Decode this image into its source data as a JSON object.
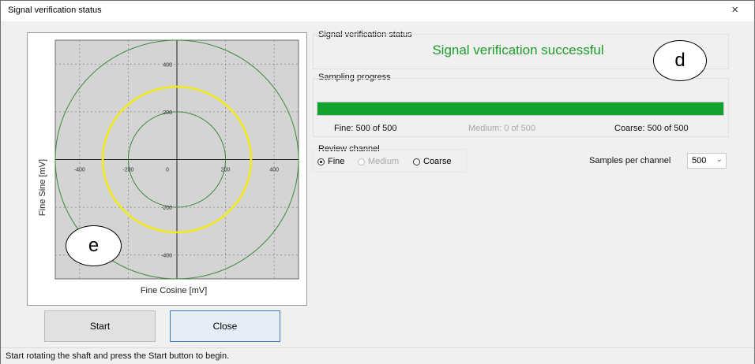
{
  "window": {
    "title": "Signal verification status",
    "close_symbol": "×"
  },
  "plot": {
    "xlabel": "Fine Cosine [mV]",
    "ylabel": "Fine Sine [mV]",
    "chart_data": {
      "type": "scatter",
      "xlim": [
        -500,
        500
      ],
      "ylim": [
        -500,
        500
      ],
      "grid": true,
      "x_ticks": [
        -400,
        -200,
        0,
        200,
        400
      ],
      "y_ticks": [
        -400,
        -200,
        0,
        200,
        400
      ],
      "x_tick_labels": [
        "-400",
        "-200",
        "0",
        "200",
        "400"
      ],
      "y_tick_labels": [
        "-400",
        "-200",
        "200",
        "400"
      ],
      "reference_circles_mV": [
        200,
        500
      ],
      "signal_circle_mV": 305,
      "colors": {
        "reference": "#3b8a3b",
        "signal": "#f4ec16",
        "plot_bg": "#d4d4d4",
        "grid": "#8a8a8a"
      }
    }
  },
  "buttons": {
    "start": "Start",
    "close": "Close"
  },
  "status_bar": {
    "message": "Start rotating the shaft and press the Start button to begin."
  },
  "verification": {
    "group_label": "Signal verification status",
    "message": "Signal verification successful",
    "color": "#1f9b2a"
  },
  "sampling": {
    "group_label": "Sampling progress",
    "progress_percent": 100,
    "fine": "Fine: 500 of 500",
    "medium": "Medium: 0 of 500",
    "coarse": "Coarse: 500 of 500",
    "bar_color": "#11a32b"
  },
  "review": {
    "group_label": "Review channel",
    "options": [
      {
        "label": "Fine",
        "selected": true,
        "enabled": true
      },
      {
        "label": "Medium",
        "selected": false,
        "enabled": false
      },
      {
        "label": "Coarse",
        "selected": false,
        "enabled": true
      }
    ]
  },
  "samples_per_channel": {
    "label": "Samples per channel",
    "value": "500",
    "caret": "⌄"
  },
  "callouts": {
    "d": "d",
    "e": "e"
  }
}
